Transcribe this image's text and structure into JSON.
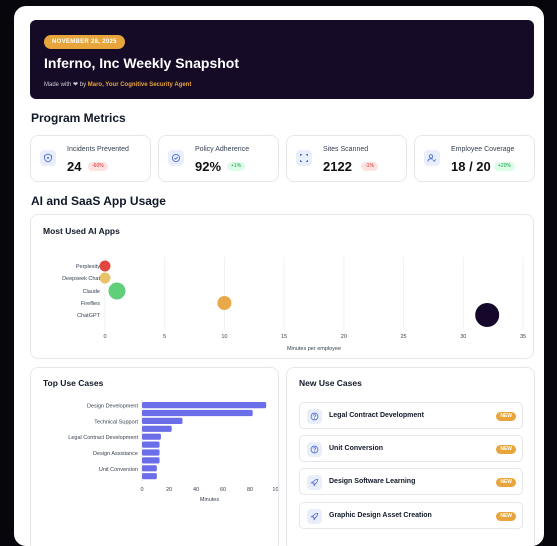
{
  "header": {
    "date_badge": "NOVEMBER 28, 2025",
    "title": "Inferno, Inc Weekly Snapshot",
    "made_with_prefix": "Made with",
    "heart": "❤",
    "by_text": "by",
    "agent_name": "Maro, Your Cognitive Security Agent",
    "badge_color": "#e8a53b",
    "background_color": "#150b26"
  },
  "metrics_section": {
    "title": "Program Metrics",
    "items": [
      {
        "label": "Incidents Prevented",
        "value": "24",
        "change": "-60%",
        "trend": "negative",
        "icon": "shield-icon"
      },
      {
        "label": "Policy Adherence",
        "value": "92%",
        "change": "+1%",
        "trend": "positive",
        "icon": "check-circle-icon"
      },
      {
        "label": "Sites Scanned",
        "value": "2122",
        "change": "-1%",
        "trend": "negative",
        "icon": "scan-frame-icon"
      },
      {
        "label": "Employee Coverage",
        "value": "18 / 20",
        "change": "+20%",
        "trend": "positive",
        "icon": "user-check-icon"
      }
    ]
  },
  "usage_section": {
    "title": "AI and SaaS App Usage"
  },
  "most_used": {
    "title": "Most Used AI Apps"
  },
  "top_use_cases": {
    "title": "Top Use Cases"
  },
  "new_use_cases": {
    "title": "New Use Cases",
    "items": [
      {
        "label": "Legal Contract Development",
        "badge": "NEW",
        "icon": "question-icon"
      },
      {
        "label": "Unit Conversion",
        "badge": "NEW",
        "icon": "question-icon"
      },
      {
        "label": "Design Software Learning",
        "badge": "NEW",
        "icon": "rocket-icon"
      },
      {
        "label": "Graphic Design Asset Creation",
        "badge": "NEW",
        "icon": "rocket-icon"
      }
    ]
  },
  "chart_data": [
    {
      "type": "scatter",
      "title": "Most Used AI Apps",
      "xlabel": "Minutes per employee",
      "ylabel": "",
      "xlim": [
        0,
        35
      ],
      "xticks": [
        0,
        5,
        10,
        15,
        20,
        25,
        30,
        35
      ],
      "categories": [
        "Perplexity",
        "Deepseek Chat",
        "Claude",
        "Fireflies",
        "ChatGPT"
      ],
      "series": [
        {
          "category": "Perplexity",
          "value": 0,
          "color": "#e2463f"
        },
        {
          "category": "Deepseek Chat",
          "value": 0,
          "color": "#e8c36a"
        },
        {
          "category": "Claude",
          "value": 1,
          "color": "#5fcf7a"
        },
        {
          "category": "Fireflies",
          "value": 10,
          "color": "#e8a94a"
        },
        {
          "category": "ChatGPT",
          "value": 32,
          "color": "#15082a"
        }
      ],
      "grid": true
    },
    {
      "type": "bar",
      "orientation": "horizontal",
      "title": "Top Use Cases",
      "xlabel": "Minutes",
      "ylabel": "",
      "xlim": [
        0,
        100
      ],
      "xticks": [
        0,
        20,
        40,
        60,
        80,
        100
      ],
      "categories": [
        "Design Development",
        "",
        "Technical Support",
        "",
        "Legal Contract Development",
        "",
        "Design Assistance",
        "",
        "Unit Conversion",
        ""
      ],
      "values": [
        92,
        82,
        30,
        22,
        14,
        13,
        13,
        13,
        11,
        11
      ],
      "bar_color": "#6b6ee8"
    }
  ]
}
